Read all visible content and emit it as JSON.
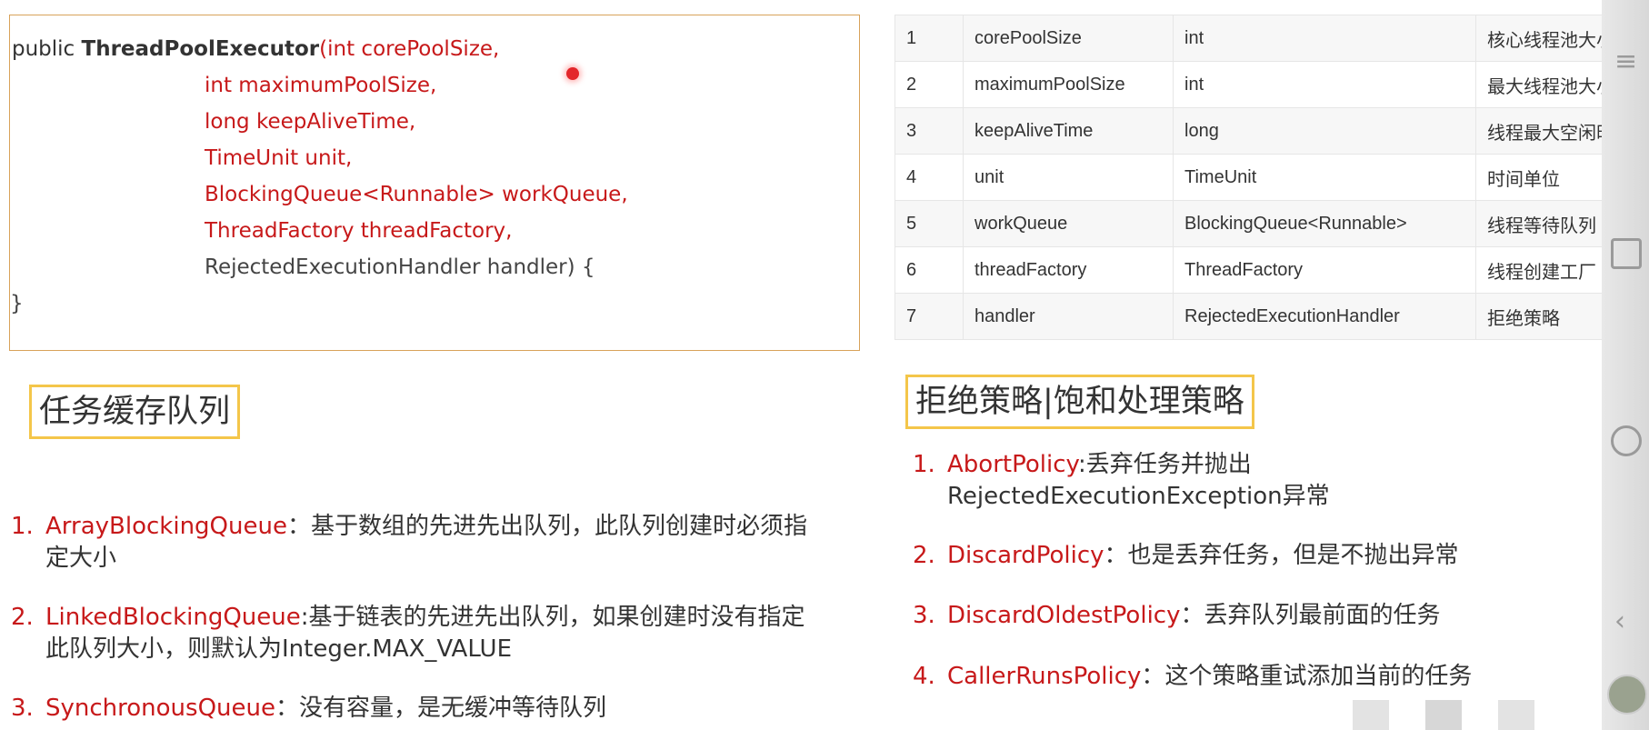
{
  "code": {
    "line1": {
      "kw": "public ",
      "fn": "ThreadPoolExecutor",
      "open": "(",
      "param": "int corePoolSize,"
    },
    "lines": [
      "int maximumPoolSize,",
      "long keepAliveTime,",
      "TimeUnit unit,",
      "BlockingQueue<Runnable> workQueue,",
      "ThreadFactory threadFactory,"
    ],
    "last_line": "RejectedExecutionHandler handler) {",
    "close": "}"
  },
  "params_table": [
    [
      "1",
      "corePoolSize",
      "int",
      "核心线程池大小"
    ],
    [
      "2",
      "maximumPoolSize",
      "int",
      "最大线程池大小"
    ],
    [
      "3",
      "keepAliveTime",
      "long",
      "线程最大空闲时间"
    ],
    [
      "4",
      "unit",
      "TimeUnit",
      "时间单位"
    ],
    [
      "5",
      "workQueue",
      "BlockingQueue<Runnable>",
      "线程等待队列"
    ],
    [
      "6",
      "threadFactory",
      "ThreadFactory",
      "线程创建工厂"
    ],
    [
      "7",
      "handler",
      "RejectedExecutionHandler",
      "拒绝策略"
    ]
  ],
  "queue_section": {
    "title": "任务缓存队列",
    "items": [
      {
        "num": "1.",
        "name": "ArrayBlockingQueue",
        "desc1": "：基于数组的先进先出队列，此队列创建时必须指",
        "desc2": "定大小"
      },
      {
        "num": "2.",
        "name": "LinkedBlockingQueue",
        "desc1": ":基于链表的先进先出队列，如果创建时没有指定",
        "desc2": "此队列大小，则默认为Integer.MAX_VALUE"
      },
      {
        "num": "3.",
        "name": "SynchronousQueue",
        "desc1": "：没有容量，是无缓冲等待队列",
        "desc2": ""
      }
    ]
  },
  "policy_section": {
    "title": "拒绝策略|饱和处理策略",
    "items": [
      {
        "num": "1.",
        "name": "AbortPolicy",
        "desc1": ":丢弃任务并抛出",
        "desc2": "RejectedExecutionException异常"
      },
      {
        "num": "2.",
        "name": "DiscardPolicy",
        "desc1": "：也是丢弃任务，但是不抛出异常",
        "desc2": ""
      },
      {
        "num": "3.",
        "name": "DiscardOldestPolicy",
        "desc1": "：丢弃队列最前面的任务",
        "desc2": ""
      },
      {
        "num": "4.",
        "name": "CallerRunsPolicy",
        "desc1": "：这个策略重试添加当前的任务",
        "desc2": ""
      }
    ]
  },
  "colors": {
    "accent_red": "#c7191a",
    "title_border": "#f4c64a",
    "code_border": "#d8a25a"
  },
  "side_icons": [
    "menu-icon",
    "square-icon",
    "circle-icon",
    "back-icon"
  ]
}
